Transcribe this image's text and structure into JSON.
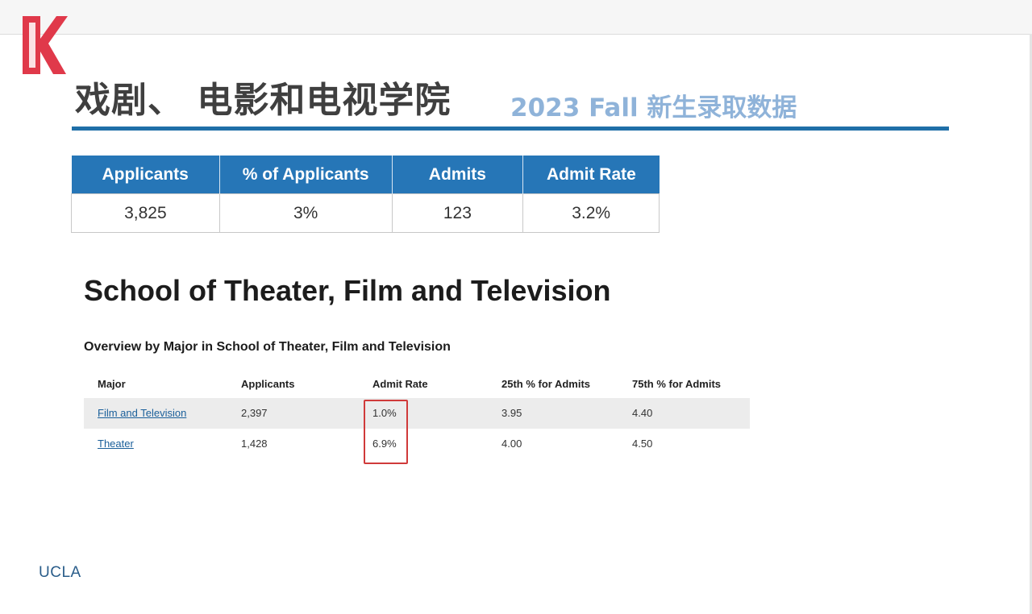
{
  "page": {
    "title": "戏剧、 电影和电视学院",
    "subtitle": "2023 Fall 新生录取数据"
  },
  "summary_table": {
    "headers": [
      "Applicants",
      "% of Applicants",
      "Admits",
      "Admit Rate"
    ],
    "values": [
      "3,825",
      "3%",
      "123",
      "3.2%"
    ]
  },
  "embedded": {
    "title": "School of Theater, Film and Television",
    "subtitle": "Overview by Major in School of Theater, Film and Television",
    "columns": [
      "Major",
      "Applicants",
      "Admit Rate",
      "25th % for Admits",
      "75th % for Admits"
    ],
    "rows": [
      [
        "Film and Television",
        "2,397",
        "1.0%",
        "3.95",
        "4.40"
      ],
      [
        "Theater",
        "1,428",
        "6.9%",
        "4.00",
        "4.50"
      ]
    ]
  },
  "footer": {
    "label": "UCLA"
  },
  "colors": {
    "header_blue": "#2676b7",
    "rule_blue": "#1f6fa8",
    "subtitle_blue": "#8fb3d9",
    "highlight_red": "#d03a3a",
    "logo_red": "#e0394a"
  },
  "icons": {
    "logo": "k-logo-icon"
  }
}
